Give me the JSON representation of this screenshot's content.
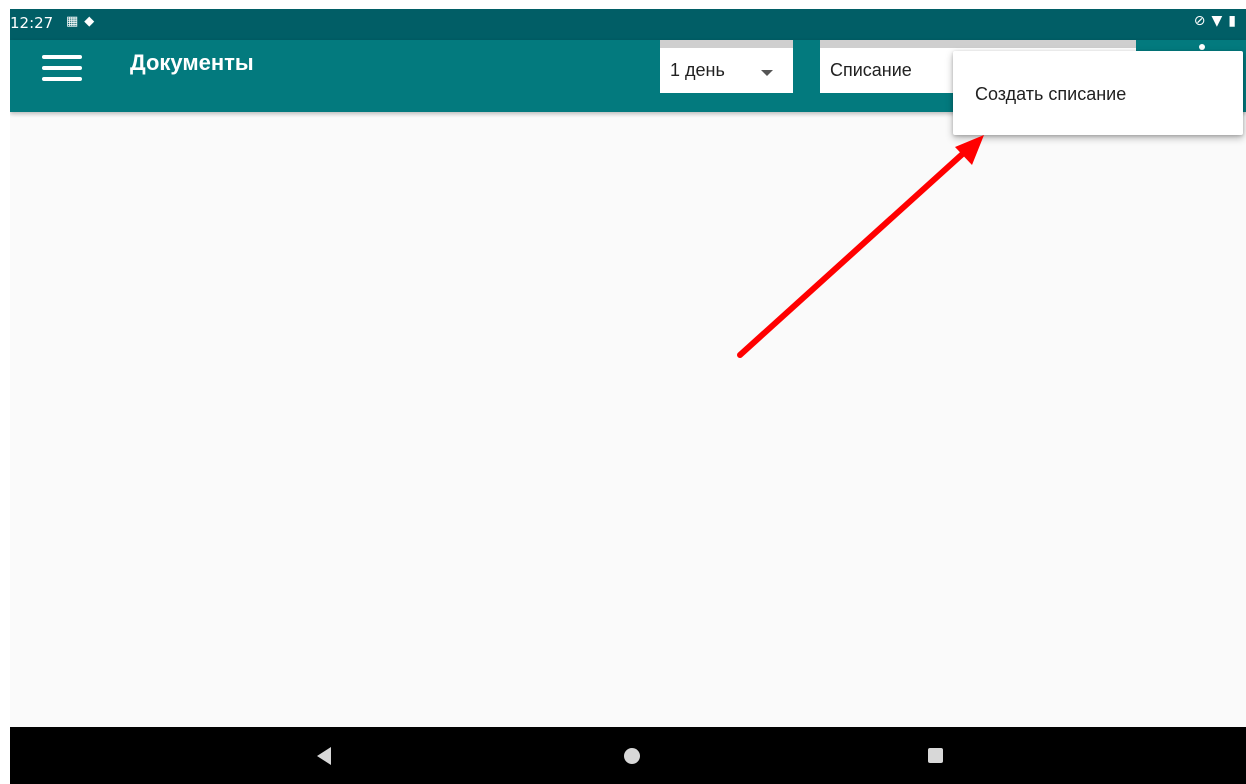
{
  "status_bar": {
    "time": "12:27",
    "left_icons": [
      "cast-icon",
      "diamond-icon"
    ],
    "right_icons": [
      "alarm-off-icon",
      "wifi-icon",
      "battery-icon"
    ]
  },
  "app_bar": {
    "title": "Документы",
    "period_select": {
      "value": "1 день"
    },
    "type_select": {
      "value": "Списание"
    }
  },
  "popup_menu": {
    "items": [
      {
        "label": "Создать списание"
      }
    ]
  },
  "annotation": {
    "arrow_color": "#ff0000"
  },
  "colors": {
    "status_bar": "#015e66",
    "app_bar": "#037a7e",
    "background": "#fafafa",
    "nav_bar": "#000000"
  },
  "nav_bar": {
    "buttons": [
      "back-icon",
      "home-icon",
      "recents-icon"
    ]
  }
}
